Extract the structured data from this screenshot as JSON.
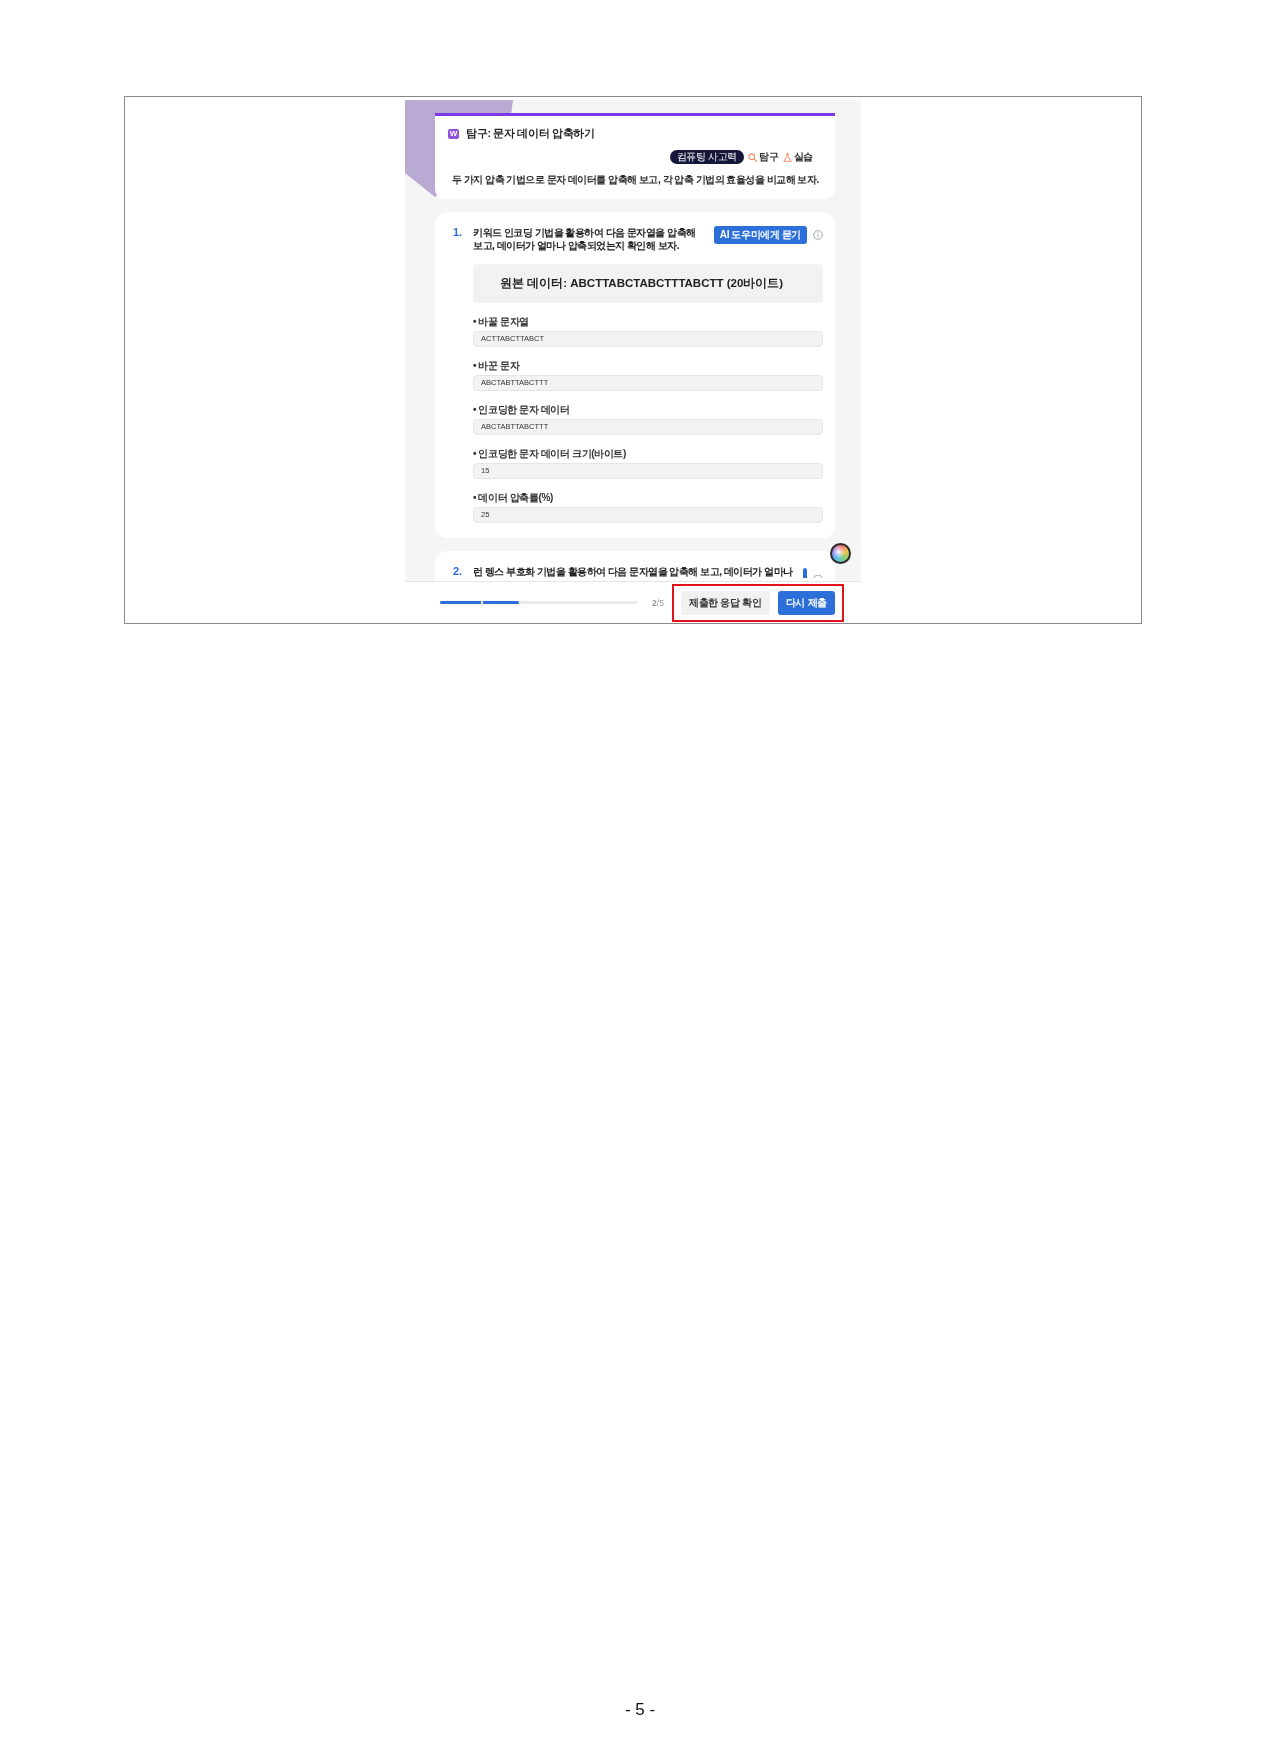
{
  "activity": {
    "badge": "W",
    "title": "탐구: 문자 데이터 압축하기",
    "tags": [
      {
        "kind": "pill",
        "label": "컴퓨팅 사고력"
      },
      {
        "kind": "search",
        "label": "탐구"
      },
      {
        "kind": "flask",
        "label": "실습"
      }
    ],
    "description": "두 가지 압축 기법으로 문자 데이터를 압축해 보고, 각 압축 기법의 효율성을 비교해 보자."
  },
  "questions": [
    {
      "kind": "full",
      "number": "1.",
      "text": "키워드 인코딩 기법을 활용하여 다음 문자열을 압축해 보고, 데이터가 얼마나 압축되었는지 확인해 보자.",
      "button": "AI 도우미에게 묻기",
      "source": "원본 데이터: ABCTTABCTABCTTTABCTT (20바이트)",
      "answers": [
        {
          "label": "• 바꿀 문자열",
          "value": "ACTTABCTTABCT"
        },
        {
          "label": "• 바꾼 문자",
          "value": "ABCTABTTABCTTT"
        },
        {
          "label": "• 인코딩한 문자 데이터",
          "value": "ABCTABTTABCTTT"
        },
        {
          "label": "• 인코딩한 문자 데이터 크기(바이트)",
          "value": "15"
        },
        {
          "label": "• 데이터 압축률(%)",
          "value": "25"
        }
      ]
    },
    {
      "kind": "cut",
      "number": "2.",
      "text": "런 렝스 부호화 기법을 활용하여 다음 문자열을 압축해 보고, 데이터가 얼마나"
    }
  ],
  "progress": {
    "level": 0.4,
    "count": "**2**/5"
  },
  "actions": {
    "highlighted": true,
    "buttons": [
      {
        "kind": "secondary",
        "label": "제출한 응답 확인"
      },
      {
        "kind": "primary",
        "label": "다시 제출"
      }
    ]
  },
  "page_number": "- 5 -"
}
